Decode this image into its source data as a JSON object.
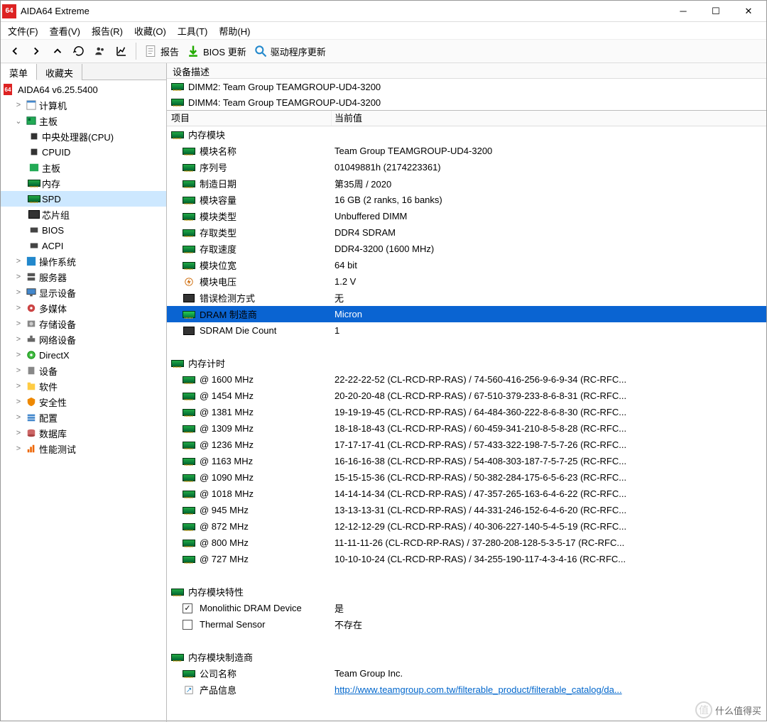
{
  "title": "AIDA64 Extreme",
  "menu": [
    "文件(F)",
    "查看(V)",
    "报告(R)",
    "收藏(O)",
    "工具(T)",
    "帮助(H)"
  ],
  "toolbar": {
    "report": "报告",
    "bios": "BIOS 更新",
    "driver": "驱动程序更新"
  },
  "leftTabs": {
    "menu": "菜单",
    "fav": "收藏夹"
  },
  "tree": {
    "root": "AIDA64 v6.25.5400",
    "computer": "计算机",
    "mobo": "主板",
    "mobo_children": {
      "cpu": "中央处理器(CPU)",
      "cpuid": "CPUID",
      "mb": "主板",
      "mem": "内存",
      "spd": "SPD",
      "chipset": "芯片组",
      "bios": "BIOS",
      "acpi": "ACPI"
    },
    "os": "操作系统",
    "server": "服务器",
    "display": "显示设备",
    "mm": "多媒体",
    "storage": "存储设备",
    "net": "网络设备",
    "dx": "DirectX",
    "dev": "设备",
    "sw": "软件",
    "sec": "安全性",
    "cfg": "配置",
    "db": "数据库",
    "bench": "性能测试"
  },
  "topHeader": "设备描述",
  "dimms": [
    "DIMM2: Team Group TEAMGROUP-UD4-3200",
    "DIMM4: Team Group TEAMGROUP-UD4-3200"
  ],
  "cols": {
    "item": "项目",
    "value": "当前值"
  },
  "sec_module": "内存模块",
  "module": [
    {
      "k": "模块名称",
      "v": "Team Group TEAMGROUP-UD4-3200"
    },
    {
      "k": "序列号",
      "v": "01049881h (2174223361)"
    },
    {
      "k": "制造日期",
      "v": "第35周 / 2020"
    },
    {
      "k": "模块容量",
      "v": "16 GB (2 ranks, 16 banks)"
    },
    {
      "k": "模块类型",
      "v": "Unbuffered DIMM"
    },
    {
      "k": "存取类型",
      "v": "DDR4 SDRAM"
    },
    {
      "k": "存取速度",
      "v": "DDR4-3200 (1600 MHz)"
    },
    {
      "k": "模块位宽",
      "v": "64 bit"
    },
    {
      "k": "模块电压",
      "v": "1.2 V",
      "icon": "volt"
    },
    {
      "k": "错误检测方式",
      "v": "无",
      "icon": "chip"
    },
    {
      "k": "DRAM 制造商",
      "v": "Micron",
      "sel": true
    },
    {
      "k": "SDRAM Die Count",
      "v": "1",
      "icon": "chip"
    }
  ],
  "sec_timing": "内存计时",
  "timing": [
    {
      "k": "@ 1600 MHz",
      "v": "22-22-22-52  (CL-RCD-RP-RAS) / 74-560-416-256-9-6-9-34  (RC-RFC..."
    },
    {
      "k": "@ 1454 MHz",
      "v": "20-20-20-48  (CL-RCD-RP-RAS) / 67-510-379-233-8-6-8-31  (RC-RFC..."
    },
    {
      "k": "@ 1381 MHz",
      "v": "19-19-19-45  (CL-RCD-RP-RAS) / 64-484-360-222-8-6-8-30  (RC-RFC..."
    },
    {
      "k": "@ 1309 MHz",
      "v": "18-18-18-43  (CL-RCD-RP-RAS) / 60-459-341-210-8-5-8-28  (RC-RFC..."
    },
    {
      "k": "@ 1236 MHz",
      "v": "17-17-17-41  (CL-RCD-RP-RAS) / 57-433-322-198-7-5-7-26  (RC-RFC..."
    },
    {
      "k": "@ 1163 MHz",
      "v": "16-16-16-38  (CL-RCD-RP-RAS) / 54-408-303-187-7-5-7-25  (RC-RFC..."
    },
    {
      "k": "@ 1090 MHz",
      "v": "15-15-15-36  (CL-RCD-RP-RAS) / 50-382-284-175-6-5-6-23  (RC-RFC..."
    },
    {
      "k": "@ 1018 MHz",
      "v": "14-14-14-34  (CL-RCD-RP-RAS) / 47-357-265-163-6-4-6-22  (RC-RFC..."
    },
    {
      "k": "@ 945 MHz",
      "v": "13-13-13-31  (CL-RCD-RP-RAS) / 44-331-246-152-6-4-6-20  (RC-RFC..."
    },
    {
      "k": "@ 872 MHz",
      "v": "12-12-12-29  (CL-RCD-RP-RAS) / 40-306-227-140-5-4-5-19  (RC-RFC..."
    },
    {
      "k": "@ 800 MHz",
      "v": "11-11-11-26  (CL-RCD-RP-RAS) / 37-280-208-128-5-3-5-17  (RC-RFC..."
    },
    {
      "k": "@ 727 MHz",
      "v": "10-10-10-24  (CL-RCD-RP-RAS) / 34-255-190-117-4-3-4-16  (RC-RFC..."
    }
  ],
  "sec_feat": "内存模块特性",
  "feat": [
    {
      "k": "Monolithic DRAM Device",
      "v": "是",
      "chk": true
    },
    {
      "k": "Thermal Sensor",
      "v": "不存在",
      "chk": false
    }
  ],
  "sec_mfr": "内存模块制造商",
  "mfr": [
    {
      "k": "公司名称",
      "v": "Team Group Inc."
    },
    {
      "k": "产品信息",
      "v": "http://www.teamgroup.com.tw/filterable_product/filterable_catalog/da...",
      "link": true,
      "icon": "link"
    }
  ],
  "watermark": "什么值得买"
}
